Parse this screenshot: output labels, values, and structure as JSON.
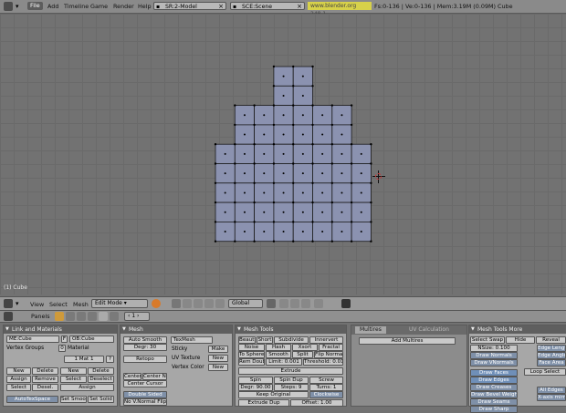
{
  "menu": {
    "file": "File",
    "add": "Add",
    "timeline": "Timeline",
    "game": "Game",
    "render": "Render",
    "help": "Help"
  },
  "screen_field": {
    "prefix": "SR:",
    "value": "SR:2-Model"
  },
  "scene_field": {
    "prefix": "SCE:",
    "value": "SCE:Scene"
  },
  "url": "www.blender.org 248.1",
  "stats": "Fs:0-136 | Ve:0-136 | Mem:3.19M (0.09M) Cube",
  "viewport": {
    "label": "(1) Cube"
  },
  "header3d": {
    "view": "View",
    "select": "Select",
    "mesh": "Mesh",
    "mode": "Edit Mode",
    "orientation": "Global"
  },
  "buttons_header": {
    "panels": "Panels",
    "page": "1"
  },
  "link_materials": {
    "title": "Link and Materials",
    "me_field": "ME:Cube",
    "f_label": "F",
    "ob_field": "OB:Cube",
    "vertex_groups": "Vertex Groups",
    "mat_count": "0",
    "material": "Material",
    "mat_index": "1 Mat 1",
    "question": "?",
    "new": "New",
    "delete": "Delete",
    "assign": "Assign",
    "remove": "Remove",
    "select": "Select",
    "deselect_short": "Desel.",
    "deselect": "Deselect",
    "new2": "New",
    "delete2": "Delete",
    "select2": "Select",
    "assign2": "Assign",
    "autotex": "AutoTexSpace",
    "set_smooth": "Set Smooth",
    "set_solid": "Set Solid"
  },
  "mesh": {
    "title": "Mesh",
    "auto_smooth": "Auto Smooth",
    "degr": "Degr: 30",
    "retopo": "Retopo",
    "texmesh": "TexMesh",
    "sticky": "Sticky",
    "make": "Make",
    "uv_texture": "UV Texture",
    "new_uv": "New",
    "vertex_color": "Vertex Color",
    "new_vc": "New",
    "center": "Center",
    "center_new": "Center New",
    "center_cursor": "Center Cursor",
    "double_sided": "Double Sided",
    "no_vnormal_flip": "No V.Normal Flip"
  },
  "mesh_tools": {
    "title": "Mesh Tools",
    "beauty": "Beauty",
    "short": "Short",
    "subdivide": "Subdivide",
    "innervert": "Innervert",
    "noise": "Noise",
    "hash": "Hash",
    "xsort": "Xsort",
    "fractal": "Fractal",
    "to_sphere": "To Sphere",
    "smooth": "Smooth",
    "split": "Split",
    "flip_normals": "Flip Normals",
    "rem_double": "Rem Double",
    "limit": "Limit: 0.001",
    "threshold": "Threshold: 0.010",
    "extrude": "Extrude",
    "spin": "Spin",
    "spin_dup": "Spin Dup",
    "screw": "Screw",
    "degr": "Degr: 90.00",
    "steps": "Steps: 9",
    "turns": "Turns: 1",
    "keep_original": "Keep Original",
    "clockwise": "Clockwise",
    "extrude_dup": "Extrude Dup",
    "offset": "Offset: 1.00"
  },
  "multires": {
    "tab1": "Multires",
    "tab2": "UV Calculation",
    "add": "Add Multires"
  },
  "mesh_tools_more": {
    "title": "Mesh Tools More",
    "select_swap": "Select Swap",
    "hide": "Hide",
    "reveal": "Reveal",
    "nsize": "NSize: 0.100",
    "draw_normals": "Draw Normals",
    "draw_vnormals": "Draw VNormals",
    "edge_length": "Edge Length",
    "edge_angles": "Edge Angles",
    "face_area": "Face Area",
    "draw_faces": "Draw Faces",
    "draw_edges": "Draw Edges",
    "draw_creases": "Draw Creases",
    "draw_bevel": "Draw Bevel Weights",
    "draw_seams": "Draw Seams",
    "draw_sharp": "Draw Sharp",
    "loop_select": "Loop Select",
    "all_edges": "All Edges",
    "xaxis_mirror": "X-axis mirror"
  },
  "colors": {
    "face": "#8b92b0",
    "edge": "#1c1c1c",
    "vertex": "#000000",
    "panel_title": "#5f5f5f",
    "selected_button": "#6f8fb8"
  }
}
